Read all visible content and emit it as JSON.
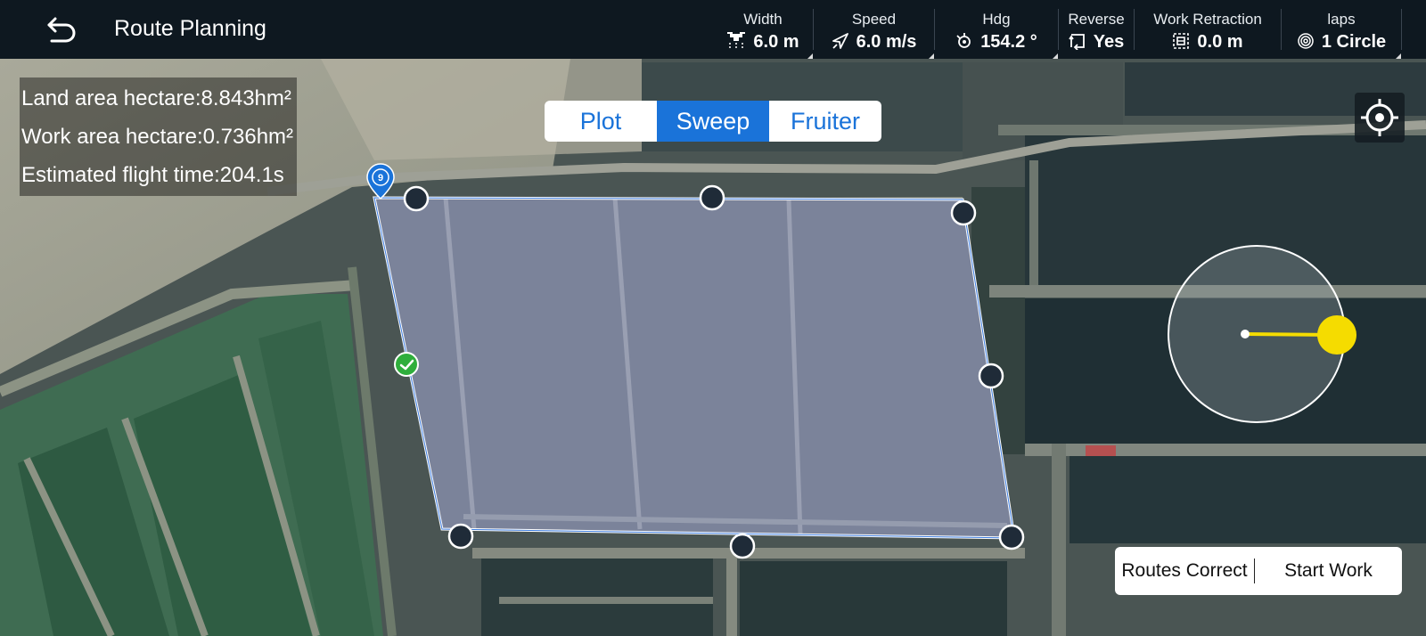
{
  "header": {
    "back_icon": "back-arrow-icon",
    "title": "Route Planning",
    "params": [
      {
        "label": "Width",
        "value": "6.0 m",
        "icon": "drone-spray-icon"
      },
      {
        "label": "Speed",
        "value": "6.0 m/s",
        "icon": "speed-arrow-icon"
      },
      {
        "label": "Hdg",
        "value": "154.2  °",
        "icon": "heading-icon"
      },
      {
        "label": "Reverse",
        "value": "Yes",
        "icon": "reverse-icon"
      },
      {
        "label": "Work Retraction",
        "value": "0.0 m",
        "icon": "retraction-icon"
      },
      {
        "label": "laps",
        "value": "1 Circle",
        "icon": "laps-spiral-icon"
      }
    ]
  },
  "stats": {
    "land_area": "Land area hectare:8.843hm²",
    "work_area": "Work area hectare:0.736hm²",
    "flight_time": "Estimated flight time:204.1s"
  },
  "mode_tabs": {
    "items": [
      "Plot",
      "Sweep",
      "Fruiter"
    ],
    "active": "Sweep"
  },
  "map": {
    "start_marker_label": "9",
    "locate_icon": "crosshair-locate-icon"
  },
  "actions": {
    "routes_correct": "Routes Correct",
    "start_work": "Start Work"
  },
  "colors": {
    "accent": "#1a73d9",
    "heading_handle": "#f5dc00",
    "boundary_line": "#ffffff",
    "vertex": "#1f2b38",
    "confirm": "#2fae3c"
  }
}
